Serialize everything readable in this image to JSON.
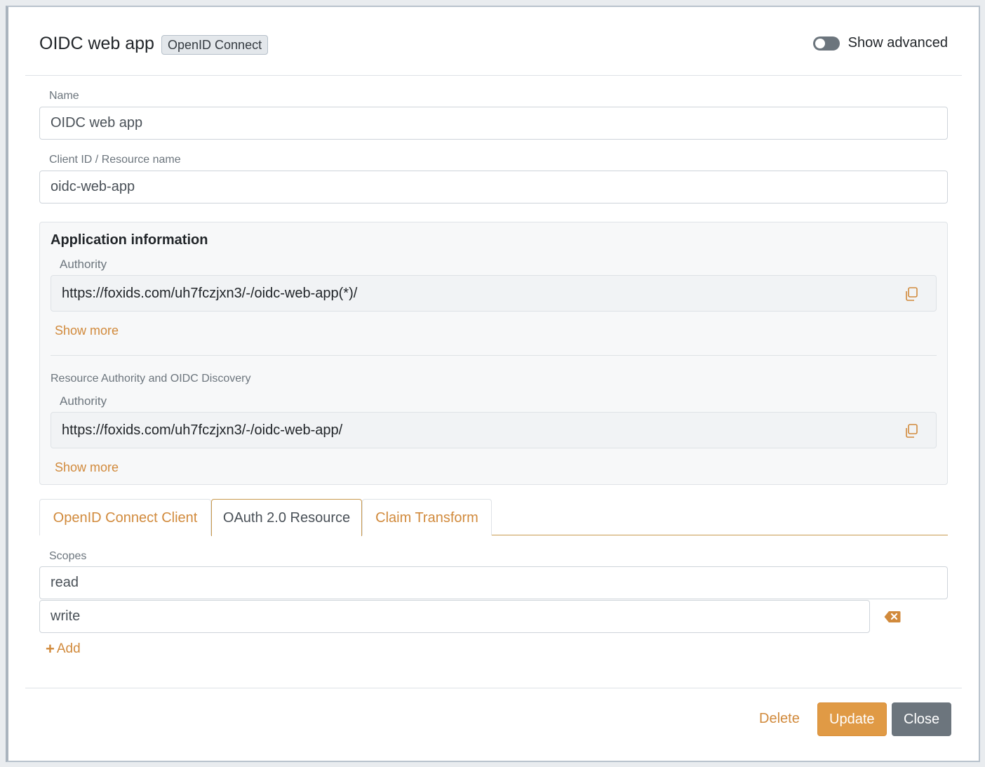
{
  "header": {
    "title": "OIDC web app",
    "badge": "OpenID Connect",
    "show_advanced_label": "Show advanced"
  },
  "fields": {
    "name_label": "Name",
    "name_value": "OIDC web app",
    "client_id_label": "Client ID / Resource name",
    "client_id_value": "oidc-web-app"
  },
  "app_info": {
    "title": "Application information",
    "authority_label": "Authority",
    "authority_value": "https://foxids.com/uh7fczjxn3/-/oidc-web-app(*)/",
    "show_more": "Show more",
    "resource_section": "Resource Authority and OIDC Discovery",
    "resource_authority_label": "Authority",
    "resource_authority_value": "https://foxids.com/uh7fczjxn3/-/oidc-web-app/",
    "resource_show_more": "Show more"
  },
  "tabs": [
    {
      "label": "OpenID Connect Client",
      "active": false
    },
    {
      "label": "OAuth 2.0 Resource",
      "active": true
    },
    {
      "label": "Claim Transform",
      "active": false
    }
  ],
  "scopes": {
    "label": "Scopes",
    "items": [
      "read",
      "write"
    ],
    "add_label": "Add"
  },
  "footer": {
    "delete_label": "Delete",
    "update_label": "Update",
    "close_label": "Close"
  },
  "colors": {
    "accent": "#d18a3c",
    "update_button": "#e09a45",
    "close_button": "#6c757d"
  },
  "icons": [
    "copy-icon",
    "backspace-icon",
    "plus-icon",
    "toggle-switch"
  ]
}
